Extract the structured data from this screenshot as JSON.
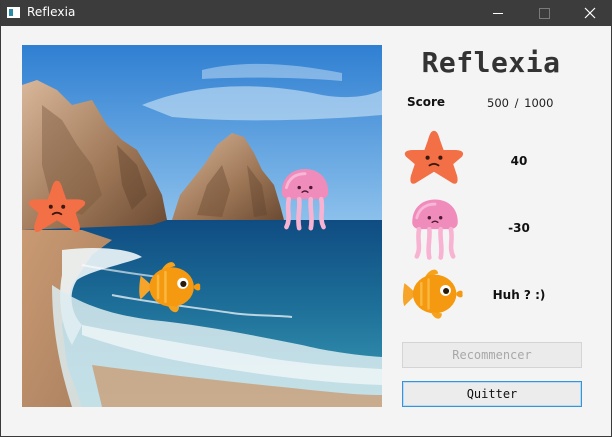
{
  "window": {
    "title": "Reflexia",
    "controls": {
      "minimize": "minimize-icon",
      "maximize": "maximize-icon",
      "close": "close-icon"
    }
  },
  "game": {
    "title": "Reflexia",
    "score_label": "Score",
    "score_current": "500",
    "score_separator": "/",
    "score_target": "1000"
  },
  "legend": [
    {
      "creature": "starfish",
      "points": "40"
    },
    {
      "creature": "jellyfish",
      "points": "-30"
    },
    {
      "creature": "fish",
      "points": "Huh ? :)"
    }
  ],
  "buttons": {
    "restart": "Recommencer",
    "quit": "Quitter"
  },
  "colors": {
    "titlebar": "#3c3c3c",
    "starfish": "#f36f45",
    "jellyfish": "#f08cbc",
    "fish": "#f59a10",
    "focus_border": "#3a93d6"
  }
}
